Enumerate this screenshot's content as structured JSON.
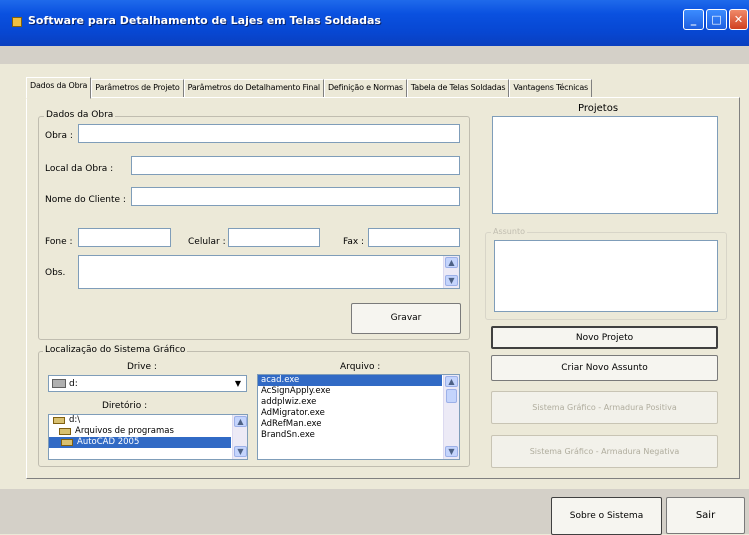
{
  "window": {
    "title": "Software para Detalhamento de Lajes em Telas Soldadas",
    "minimize_glyph": "_",
    "maximize_glyph": "□",
    "close_glyph": "✕"
  },
  "tabs": [
    {
      "label": "Dados da Obra"
    },
    {
      "label": "Parâmetros de Projeto"
    },
    {
      "label": "Parâmetros do Detalhamento Final"
    },
    {
      "label": "Definição e Normas"
    },
    {
      "label": "Tabela de Telas Soldadas"
    },
    {
      "label": "Vantagens Técnicas"
    }
  ],
  "dados_obra": {
    "group_title": "Dados da Obra",
    "obra_label": "Obra :",
    "obra_value": "",
    "local_label": "Local da Obra :",
    "local_value": "",
    "cliente_label": "Nome do Cliente :",
    "cliente_value": "",
    "fone_label": "Fone :",
    "fone_value": "",
    "celular_label": "Celular :",
    "celular_value": "",
    "fax_label": "Fax :",
    "fax_value": "",
    "obs_label": "Obs.",
    "obs_value": "",
    "gravar_label": "Gravar"
  },
  "localizacao": {
    "group_title": "Localização do Sistema Gráfico",
    "drive_label": "Drive :",
    "drive_value": "d:",
    "diretorio_label": "Diretório :",
    "diretorio_items": [
      "d:\\",
      "Arquivos de programas",
      "AutoCAD 2005"
    ],
    "arquivo_label": "Arquivo :",
    "arquivo_items": [
      "acad.exe",
      "AcSignApply.exe",
      "addplwiz.exe",
      "AdMigrator.exe",
      "AdRefMan.exe",
      "BrandSn.exe"
    ]
  },
  "projetos": {
    "label": "Projetos",
    "assunto_label": "Assunto"
  },
  "buttons": {
    "novo_projeto": "Novo Projeto",
    "criar_novo_assunto": "Criar Novo Assunto",
    "sistema_positiva": "Sistema Gráfico - Armadura Positiva",
    "sistema_negativa": "Sistema Gráfico - Armadura Negativa",
    "sobre": "Sobre o Sistema",
    "sair": "Sair"
  },
  "scroll_glyphs": {
    "up": "▲",
    "down": "▼"
  },
  "dropdown_glyph": "▼",
  "colors": {
    "titlebar": "#0a51e0",
    "selection": "#316ac5",
    "face": "#ece9d8"
  }
}
